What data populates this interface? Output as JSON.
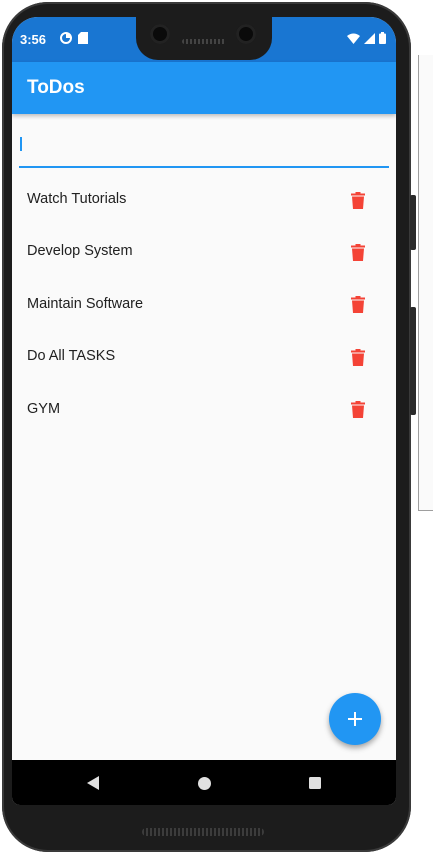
{
  "status_bar": {
    "time": "3:56",
    "left_icons": [
      "data-saver-icon",
      "sd-card-icon"
    ],
    "right_icons": [
      "wifi-icon",
      "signal-icon",
      "battery-icon"
    ]
  },
  "app_bar": {
    "title": "ToDos"
  },
  "input": {
    "value": "",
    "placeholder": ""
  },
  "todos": [
    {
      "text": "Watch Tutorials",
      "icon": "delete-icon"
    },
    {
      "text": "Develop System",
      "icon": "delete-icon"
    },
    {
      "text": "Maintain Software",
      "icon": "delete-icon"
    },
    {
      "text": "Do All TASKS",
      "icon": "delete-icon"
    },
    {
      "text": "GYM",
      "icon": "delete-icon"
    }
  ],
  "fab": {
    "icon": "add-icon",
    "symbol": "+"
  },
  "nav": {
    "icons": [
      "back-icon",
      "home-icon",
      "recents-icon"
    ]
  },
  "colors": {
    "primary": "#2196f3",
    "status_bar": "#1976d2",
    "delete": "#f44336",
    "background": "#fafafa"
  }
}
